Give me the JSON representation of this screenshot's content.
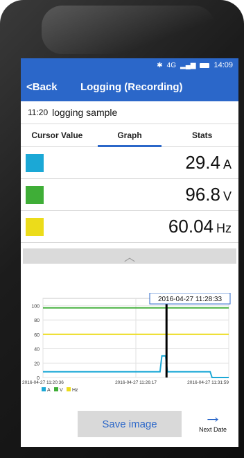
{
  "status_bar": {
    "bluetooth_icon": "bluetooth-icon",
    "network": "4G",
    "time": "14:09"
  },
  "app_bar": {
    "back_label": "<Back",
    "title": "Logging (Recording)"
  },
  "record": {
    "time": "11:20",
    "name": "logging sample"
  },
  "tabs": [
    {
      "label": "Cursor Value",
      "active": false
    },
    {
      "label": "Graph",
      "active": true
    },
    {
      "label": "Stats",
      "active": false
    }
  ],
  "values": [
    {
      "color": "#1ba8d6",
      "value": "29.4",
      "unit": "A"
    },
    {
      "color": "#3fae37",
      "value": "96.8",
      "unit": "V"
    },
    {
      "color": "#ecdc1a",
      "value": "60.04",
      "unit": "Hz"
    }
  ],
  "collapse_icon": "chevron-up-icon",
  "chart_data": {
    "type": "line",
    "y_ticks": [
      0,
      20,
      40,
      60,
      80,
      100
    ],
    "ylim": [
      0,
      110
    ],
    "x_tick_labels": [
      "2016-04-27 11:20:36",
      "2016-04-27 11:26:17",
      "2016-04-27 11:31:59"
    ],
    "cursor_label": "2016-04-27 11:28:33",
    "legend": [
      "A",
      "V",
      "Hz"
    ],
    "series": [
      {
        "name": "A",
        "color": "#1ba8d6",
        "x": [
          0,
          0.63,
          0.64,
          0.66,
          0.67,
          0.9,
          0.91,
          1.0
        ],
        "y": [
          8,
          8,
          30,
          30,
          8,
          8,
          0,
          0
        ]
      },
      {
        "name": "V",
        "color": "#3fae37",
        "x": [
          0,
          1.0
        ],
        "y": [
          96.8,
          96.8
        ]
      },
      {
        "name": "Hz",
        "color": "#ecdc1a",
        "x": [
          0,
          1.0
        ],
        "y": [
          60.04,
          60.04
        ]
      }
    ],
    "cursor_x": 0.665
  },
  "bottom": {
    "save_label": "Save image",
    "next_label": "Next Date"
  }
}
